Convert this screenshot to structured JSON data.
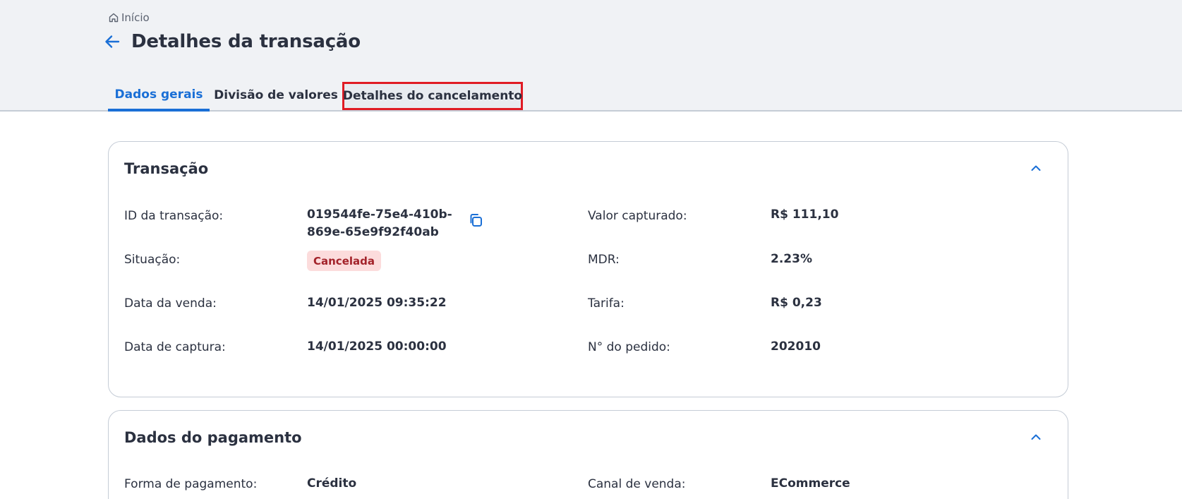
{
  "breadcrumb": {
    "home_label": "Início"
  },
  "page": {
    "title": "Detalhes da transação"
  },
  "tabs": [
    {
      "label": "Dados gerais"
    },
    {
      "label": "Divisão de valores"
    },
    {
      "label": "Detalhes do cancelamento"
    }
  ],
  "transacao": {
    "title": "Transação",
    "id_label": "ID da transação:",
    "id_value_line1": "019544fe-75e4-410b-",
    "id_value_line2": "869e-65e9f92f40ab",
    "situacao_label": "Situação:",
    "situacao_value": "Cancelada",
    "data_venda_label": "Data da venda:",
    "data_venda_value": "14/01/2025 09:35:22",
    "data_captura_label": "Data de captura:",
    "data_captura_value": "14/01/2025 00:00:00",
    "valor_capturado_label": "Valor capturado:",
    "valor_capturado_value": "R$ 111,10",
    "mdr_label": "MDR:",
    "mdr_value": "2.23%",
    "tarifa_label": "Tarifa:",
    "tarifa_value": "R$ 0,23",
    "pedido_label": "N° do pedido:",
    "pedido_value": "202010"
  },
  "pagamento": {
    "title": "Dados do pagamento",
    "forma_label": "Forma de pagamento:",
    "forma_value": "Crédito",
    "canal_label": "Canal de venda:",
    "canal_value": "ECommerce"
  },
  "colors": {
    "accent": "#1a6fd6",
    "highlight_border": "#e01b24",
    "badge_bg": "#fcdcdc",
    "badge_text": "#a3232a"
  },
  "icons": {
    "home": "home-icon",
    "back": "arrow-left-icon",
    "copy": "copy-icon",
    "collapse": "chevron-up-icon"
  }
}
